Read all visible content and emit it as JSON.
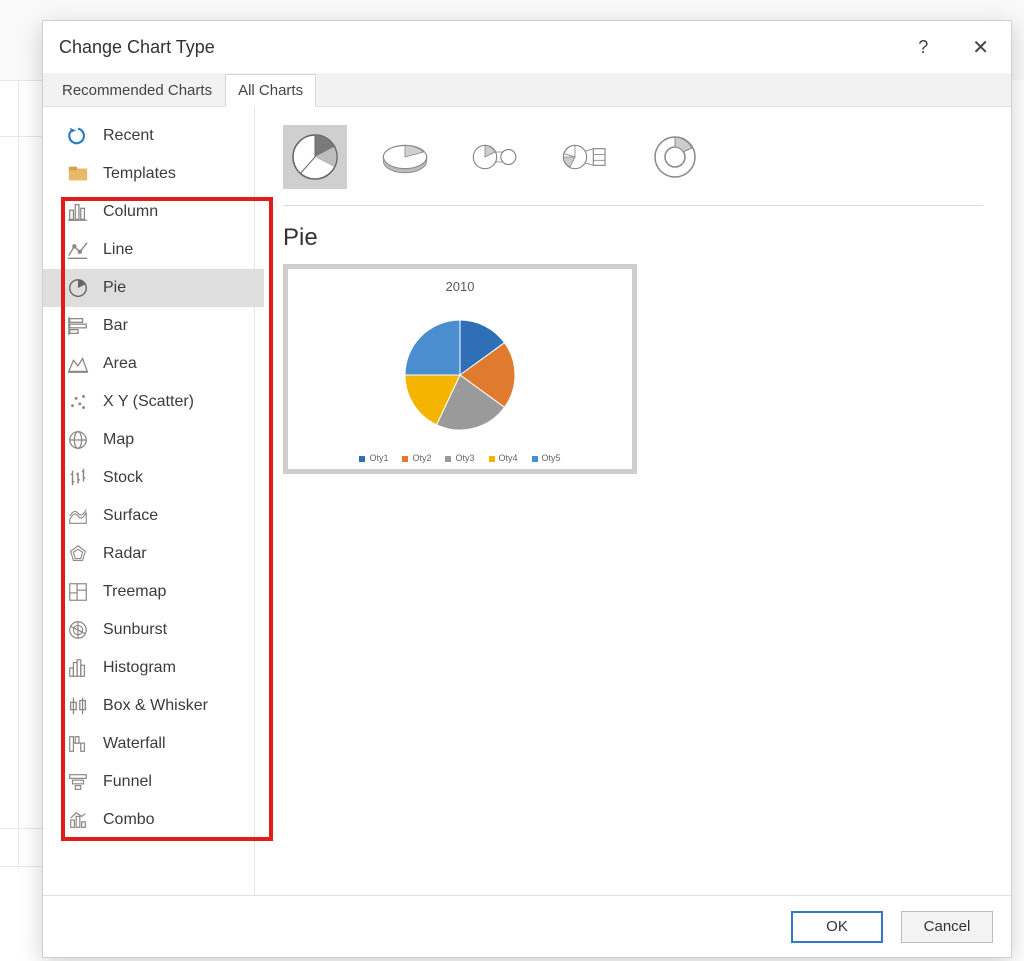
{
  "dialog_title": "Change Chart Type",
  "help_label": "?",
  "close_label": "✕",
  "tabs": {
    "recommended": "Recommended Charts",
    "all": "All Charts"
  },
  "categories": [
    {
      "id": "recent",
      "label": "Recent"
    },
    {
      "id": "templates",
      "label": "Templates"
    },
    {
      "id": "column",
      "label": "Column"
    },
    {
      "id": "line",
      "label": "Line"
    },
    {
      "id": "pie",
      "label": "Pie"
    },
    {
      "id": "bar",
      "label": "Bar"
    },
    {
      "id": "area",
      "label": "Area"
    },
    {
      "id": "scatter",
      "label": "X Y (Scatter)"
    },
    {
      "id": "map",
      "label": "Map"
    },
    {
      "id": "stock",
      "label": "Stock"
    },
    {
      "id": "surface",
      "label": "Surface"
    },
    {
      "id": "radar",
      "label": "Radar"
    },
    {
      "id": "treemap",
      "label": "Treemap"
    },
    {
      "id": "sunburst",
      "label": "Sunburst"
    },
    {
      "id": "histogram",
      "label": "Histogram"
    },
    {
      "id": "boxwhisker",
      "label": "Box & Whisker"
    },
    {
      "id": "waterfall",
      "label": "Waterfall"
    },
    {
      "id": "funnel",
      "label": "Funnel"
    },
    {
      "id": "combo",
      "label": "Combo"
    }
  ],
  "selected_category": "pie",
  "subtype_title": "Pie",
  "subtypes": [
    {
      "id": "pie",
      "label": "Pie"
    },
    {
      "id": "pie3d",
      "label": "3-D Pie"
    },
    {
      "id": "pieofpie",
      "label": "Pie of Pie"
    },
    {
      "id": "barofpie",
      "label": "Bar of Pie"
    },
    {
      "id": "doughnut",
      "label": "Doughnut"
    }
  ],
  "selected_subtype": "pie",
  "preview": {
    "title": "2010",
    "legend": [
      "Oty1",
      "Oty2",
      "Oty3",
      "Oty4",
      "Oty5"
    ]
  },
  "buttons": {
    "ok": "OK",
    "cancel": "Cancel"
  },
  "colors": {
    "slice1": "#2f6fb7",
    "slice2": "#e07a2e",
    "slice3": "#9a9a9a",
    "slice4": "#f4b400",
    "slice5": "#4a8ecf"
  },
  "chart_data": {
    "type": "pie",
    "title": "2010",
    "categories": [
      "Oty1",
      "Oty2",
      "Oty3",
      "Oty4",
      "Oty5"
    ],
    "values": [
      15,
      20,
      22,
      18,
      25
    ],
    "colors": [
      "#2f6fb7",
      "#e07a2e",
      "#9a9a9a",
      "#f4b400",
      "#4a8ecf"
    ]
  }
}
